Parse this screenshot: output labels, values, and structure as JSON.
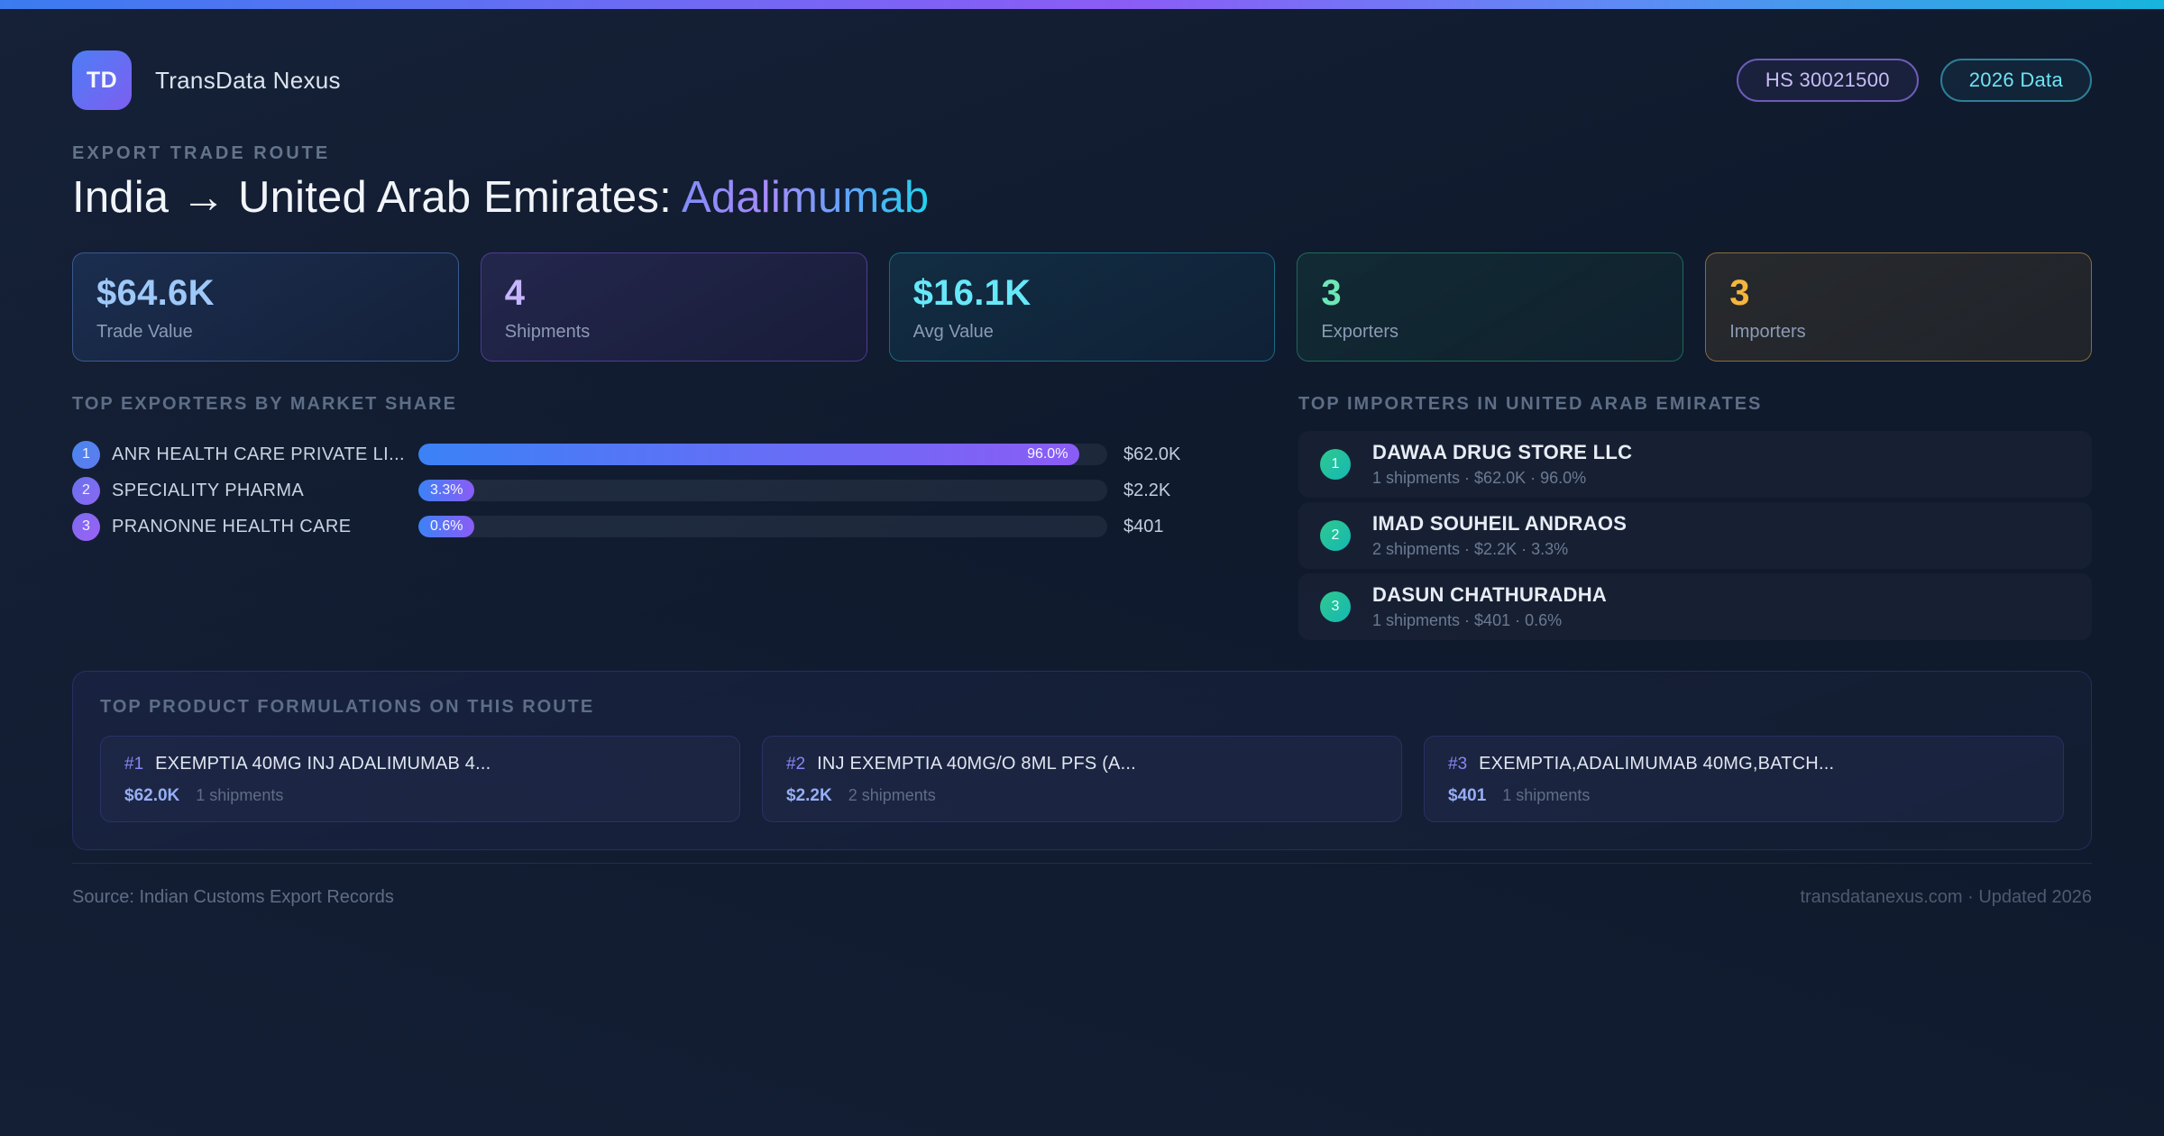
{
  "header": {
    "logo_text": "TD",
    "app_name": "TransData Nexus",
    "badges": [
      {
        "label": "HS 30021500"
      },
      {
        "label": "2026 Data"
      }
    ]
  },
  "hero": {
    "eyebrow": "EXPORT TRADE ROUTE",
    "title_prefix": "India → United Arab Emirates: ",
    "title_highlight": "Adalimumab"
  },
  "stats": [
    {
      "value": "$64.6K",
      "label": "Trade Value",
      "accent": "#9ec8f7"
    },
    {
      "value": "4",
      "label": "Shipments",
      "accent": "#c4b5fd"
    },
    {
      "value": "$16.1K",
      "label": "Avg Value",
      "accent": "#67e8f9"
    },
    {
      "value": "3",
      "label": "Exporters",
      "accent": "#6ee7b7"
    },
    {
      "value": "3",
      "label": "Importers",
      "accent": "#f5b63c"
    }
  ],
  "exporters": {
    "title": "TOP EXPORTERS BY MARKET SHARE",
    "items": [
      {
        "rank": "1",
        "name": "ANR HEALTH CARE PRIVATE LI...",
        "share_label": "96.0%",
        "share_pct": 96.0,
        "value": "$62.0K"
      },
      {
        "rank": "2",
        "name": "SPECIALITY PHARMA",
        "share_label": "3.3%",
        "share_pct": 3.3,
        "value": "$2.2K"
      },
      {
        "rank": "3",
        "name": "PRANONNE HEALTH CARE",
        "share_label": "0.6%",
        "share_pct": 0.6,
        "value": "$401"
      }
    ]
  },
  "importers": {
    "title": "TOP IMPORTERS IN UNITED ARAB EMIRATES",
    "items": [
      {
        "rank": "1",
        "name": "DAWAA DRUG STORE LLC",
        "meta": "1 shipments · $62.0K · 96.0%"
      },
      {
        "rank": "2",
        "name": "IMAD SOUHEIL ANDRAOS",
        "meta": "2 shipments · $2.2K · 3.3%"
      },
      {
        "rank": "3",
        "name": "DASUN CHATHURADHA",
        "meta": "1 shipments · $401 · 0.6%"
      }
    ]
  },
  "products": {
    "title": "TOP PRODUCT FORMULATIONS ON THIS ROUTE",
    "items": [
      {
        "rank": "#1",
        "name": "EXEMPTIA 40MG INJ ADALIMUMAB 4...",
        "value": "$62.0K",
        "shipments": "1 shipments"
      },
      {
        "rank": "#2",
        "name": "INJ EXEMPTIA 40MG/O 8ML PFS (A...",
        "value": "$2.2K",
        "shipments": "2 shipments"
      },
      {
        "rank": "#3",
        "name": "EXEMPTIA,ADALIMUMAB 40MG,BATCH...",
        "value": "$401",
        "shipments": "1 shipments"
      }
    ]
  },
  "footer": {
    "source": "Source: Indian Customs Export Records",
    "site": "transdatanexus.com · Updated 2026"
  },
  "colors": {
    "topbar_gradient_start": "#3b7bf0",
    "topbar_gradient_mid": "#8b5cf6",
    "topbar_gradient_end": "#17b5dd",
    "bar_gradient_start": "#3b82f6",
    "bar_gradient_end": "#8b5cf6",
    "importer_dot": "#14b8a6",
    "background": "#101a2d"
  }
}
